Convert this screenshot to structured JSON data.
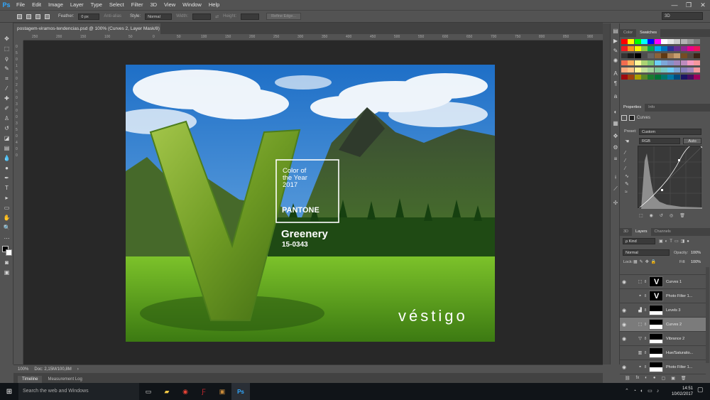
{
  "app": {
    "logo": "Ps",
    "window_controls": [
      "—",
      "❐",
      "✕"
    ]
  },
  "menu": [
    "File",
    "Edit",
    "Image",
    "Layer",
    "Type",
    "Select",
    "Filter",
    "3D",
    "View",
    "Window",
    "Help"
  ],
  "options": {
    "feather_label": "Feather:",
    "feather_value": "0 px",
    "antialias": "Anti-alias",
    "style_label": "Style:",
    "style_value": "Normal",
    "width_label": "Width:",
    "height_label": "Height:",
    "refine_edge": "Refine Edge...",
    "workspace": "3D"
  },
  "document": {
    "tab_title": "postagem-viramos-tendencias.psd @ 100% (Curves 2, Layer Mask/8)",
    "close": "×"
  },
  "rulers": {
    "h": [
      "250",
      "200",
      "150",
      "100",
      "50",
      "0",
      "50",
      "100",
      "150",
      "200",
      "250",
      "300",
      "350",
      "400",
      "450",
      "500",
      "550",
      "600",
      "650",
      "700",
      "750",
      "800",
      "850",
      "900"
    ],
    "v": [
      "0",
      "5",
      "0",
      "1",
      "5",
      "0",
      "2",
      "5",
      "0",
      "3",
      "0",
      "0",
      "3",
      "5",
      "0",
      "4",
      "0",
      "0"
    ]
  },
  "artwork": {
    "pantone_line1": "Color of",
    "pantone_line2": "the Year",
    "pantone_line3": "2017",
    "pantone_brand": "PANTONE",
    "color_name": "Greenery",
    "color_code": "15-0343",
    "brand": "véstigo"
  },
  "status": {
    "zoom": "100%",
    "doc": "Doc: 2,15M/100,8M",
    "arrow": "›"
  },
  "timeline_tabs": [
    "Timeline",
    "Measurement Log"
  ],
  "color_panel": {
    "tabs": [
      "Color",
      "Swatches"
    ]
  },
  "swatch_colors": [
    "#ff0000",
    "#ffff00",
    "#00ff00",
    "#00ffff",
    "#0000ff",
    "#ff00ff",
    "#ffffff",
    "#e5e5e5",
    "#cccccc",
    "#b3b3b3",
    "#999999",
    "#808080",
    "#ed1c24",
    "#f7941d",
    "#fff200",
    "#8dc63f",
    "#00a651",
    "#00aeef",
    "#0072bc",
    "#2e3192",
    "#662d91",
    "#92278f",
    "#ec008c",
    "#ed145b",
    "#333333",
    "#1a1a1a",
    "#000000",
    "#4d4d4d",
    "#666666",
    "#8c6239",
    "#603913",
    "#a67c52",
    "#c69c6d",
    "#754c24",
    "#534741",
    "#3c2415",
    "#f26c4f",
    "#fbaf5d",
    "#fff799",
    "#acd373",
    "#7cc576",
    "#6dcff6",
    "#7da7d9",
    "#8393ca",
    "#a186be",
    "#bd8cbf",
    "#f49ac2",
    "#f6989d",
    "#f9ad81",
    "#fdc689",
    "#fff79a",
    "#c4df9b",
    "#a3d39c",
    "#82ca9c",
    "#7accc8",
    "#6ecff6",
    "#7ea7d8",
    "#8781bd",
    "#a187be",
    "#f5989d",
    "#9e0b0f",
    "#a0410d",
    "#aba000",
    "#598527",
    "#197b30",
    "#007236",
    "#00746b",
    "#0076a3",
    "#004b80",
    "#1b1464",
    "#440e62",
    "#9e005d"
  ],
  "properties": {
    "tabs": [
      "Properties",
      "Info"
    ],
    "title": "Curves",
    "preset_label": "Preset:",
    "preset_value": "Custom",
    "channel": "RGB",
    "auto": "Auto"
  },
  "layers_panel": {
    "tabs": [
      "3D",
      "Layers",
      "Channels"
    ],
    "kind": "ρ Kind",
    "blend": "Normal",
    "opacity_label": "Opacity:",
    "opacity_value": "100%",
    "lock_label": "Lock:",
    "fill_label": "Fill:",
    "fill_value": "100%",
    "layers": [
      {
        "name": "Curves 1",
        "icon": "curves",
        "visible": true,
        "sel": false
      },
      {
        "name": "Photo Filter 1...",
        "icon": "photo",
        "visible": false,
        "sel": false
      },
      {
        "name": "Levels 3",
        "icon": "levels",
        "visible": true,
        "sel": false
      },
      {
        "name": "Curves 2",
        "icon": "curves",
        "visible": true,
        "sel": true
      },
      {
        "name": "Vibrance 2",
        "icon": "vibrance",
        "visible": true,
        "sel": false
      },
      {
        "name": "Hue/Saturatio...",
        "icon": "hue",
        "visible": false,
        "sel": false
      },
      {
        "name": "Photo Filter 1...",
        "icon": "photo",
        "visible": true,
        "sel": false
      }
    ],
    "footer_icons": [
      "⛓",
      "fx",
      "◐",
      "●",
      "▢",
      "▣",
      "🗑"
    ]
  },
  "taskbar": {
    "search": "Search the web and Windows",
    "time": "14:51",
    "date": "10/02/2017"
  }
}
